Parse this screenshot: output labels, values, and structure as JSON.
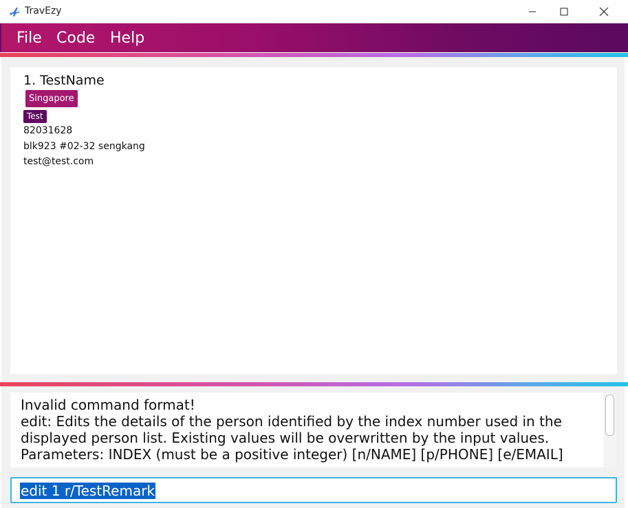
{
  "window": {
    "title": "TravEzy",
    "icon": "airplane-icon",
    "controls": [
      "minimize-icon",
      "maximize-icon",
      "close-icon"
    ]
  },
  "menu": {
    "items": [
      "File",
      "Code",
      "Help"
    ],
    "colors": {
      "start": "#b3166b",
      "end": "#5a0a5f"
    }
  },
  "person_list": {
    "cards": [
      {
        "index_name": "1.  TestName",
        "location": "Singapore",
        "tags": [
          "Test"
        ],
        "phone": "82031628",
        "address": "blk923 #02-32 sengkang",
        "email": "test@test.com"
      }
    ]
  },
  "result": {
    "text": "Invalid command format! \nedit: Edits the details of the person identified by the index number used in the displayed person list. Existing values will be overwritten by the input values.\nParameters: INDEX (must be a positive integer) [n/NAME] [p/PHONE] [e/EMAIL]"
  },
  "command": {
    "value": "edit 1 r/TestRemark"
  },
  "colors": {
    "accent_location_tag": "#a3176f",
    "accent_tag": "#5f0a5e",
    "command_border": "#3bb5e6",
    "selection": "#0a64c8"
  }
}
